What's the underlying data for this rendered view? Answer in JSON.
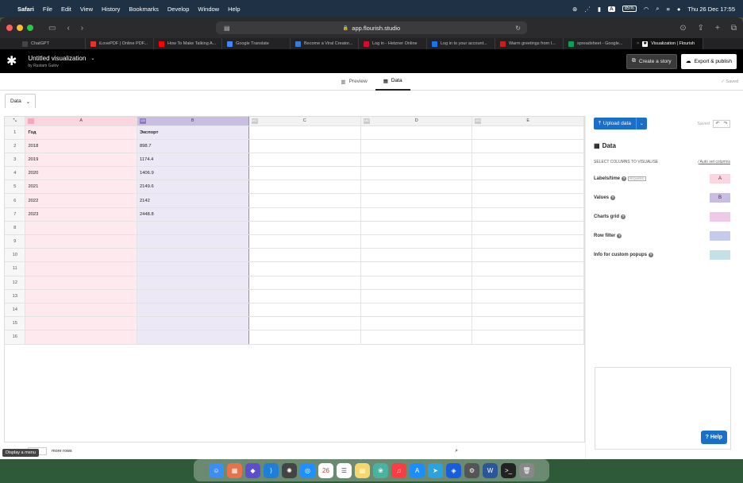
{
  "menubar": {
    "app": "Safari",
    "items": [
      "File",
      "Edit",
      "View",
      "History",
      "Bookmarks",
      "Develop",
      "Window",
      "Help"
    ],
    "input_source": "A",
    "battery": "85%",
    "datetime": "Thu 26 Dec  17:55"
  },
  "browser": {
    "url": "app.flourish.studio",
    "tabs": [
      {
        "label": "ChatGPT",
        "color": "#444"
      },
      {
        "label": "iLovePDF | Online PDF...",
        "color": "#e5322d"
      },
      {
        "label": "How To Make Talking A...",
        "color": "#ff0000"
      },
      {
        "label": "Google Translate",
        "color": "#4285f4"
      },
      {
        "label": "Become a Viral Creator...",
        "color": "#3a7bd5"
      },
      {
        "label": "Log in - Hetzner Online",
        "color": "#d50c2d"
      },
      {
        "label": "Log in to your account...",
        "color": "#1a73e8"
      },
      {
        "label": "Warm greetings from I...",
        "color": "#c5221f"
      },
      {
        "label": "spreadsheet - Google...",
        "color": "#0f9d58"
      },
      {
        "label": "Visualization | Flourish",
        "color": "#000"
      }
    ]
  },
  "flourish": {
    "title": "Untitled visualization",
    "byline": "by Rustam Gulov",
    "create_story": "Create a story",
    "export_publish": "Export & publish",
    "preview_tab": "Preview",
    "data_tab": "Data",
    "saved_status": "✓ Saved"
  },
  "sheet": {
    "tab_label": "Data",
    "columns": [
      "A",
      "B",
      "C",
      "D",
      "E"
    ],
    "row_numbers": [
      "1",
      "2",
      "3",
      "4",
      "5",
      "6",
      "7",
      "8",
      "9",
      "10",
      "11",
      "12",
      "13",
      "14",
      "15",
      "16"
    ],
    "rows": [
      [
        "Год",
        "Экспорт"
      ],
      [
        "2018",
        "898.7"
      ],
      [
        "2019",
        "1174.4"
      ],
      [
        "2020",
        "1406.9"
      ],
      [
        "2021",
        "2149.6"
      ],
      [
        "2022",
        "2142"
      ],
      [
        "2023",
        "2448.8"
      ]
    ],
    "footer_more_rows": "more rows"
  },
  "panel": {
    "upload_label": "Upload data",
    "saved": "Saved",
    "title": "Data",
    "select_columns": "SELECT COLUMNS TO VISUALISE",
    "auto_set": "Auto set columns",
    "bindings": [
      {
        "label": "Labels/time",
        "required": "REQUIRED",
        "value": "A",
        "color": "#fbd5df"
      },
      {
        "label": "Values",
        "required": "",
        "value": "B",
        "color": "#c9bde4"
      },
      {
        "label": "Charts grid",
        "required": "",
        "value": "",
        "color": "#efc9e8"
      },
      {
        "label": "Row filter",
        "required": "",
        "value": "",
        "color": "#c6cbee"
      },
      {
        "label": "Info for custom popups",
        "required": "",
        "value": "",
        "color": "#c6e0e8"
      }
    ],
    "help": "? Help"
  },
  "tooltip": "Display a menu"
}
